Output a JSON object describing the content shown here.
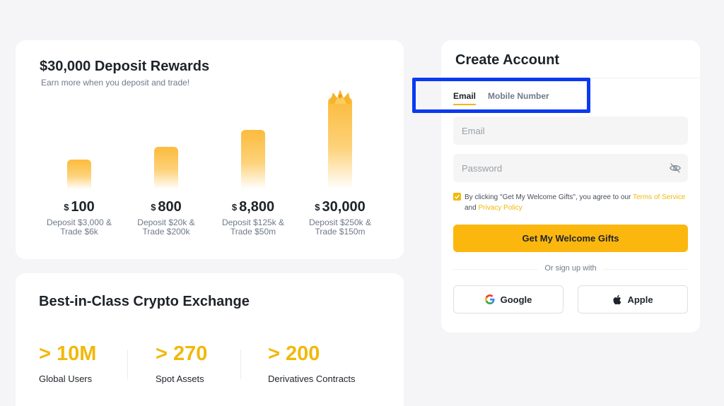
{
  "rewards": {
    "title": "$30,000 Deposit Rewards",
    "subtitle": "Earn more when you deposit and trade!",
    "currency_symbol": "$",
    "tiers": [
      {
        "amount": "100",
        "desc_line1": "Deposit $3,000 &",
        "desc_line2": "Trade $6k"
      },
      {
        "amount": "800",
        "desc_line1": "Deposit $20k &",
        "desc_line2": "Trade $200k"
      },
      {
        "amount": "8,800",
        "desc_line1": "Deposit $125k &",
        "desc_line2": "Trade $50m"
      },
      {
        "amount": "30,000",
        "desc_line1": "Deposit $250k &",
        "desc_line2": "Trade $150m"
      }
    ]
  },
  "stats": {
    "title": "Best-in-Class Crypto Exchange",
    "items": [
      {
        "value": "> 10M",
        "label": "Global Users"
      },
      {
        "value": "> 270",
        "label": "Spot Assets"
      },
      {
        "value": "> 200",
        "label": "Derivatives Contracts"
      }
    ]
  },
  "signup": {
    "title": "Create Account",
    "tabs": [
      {
        "label": "Email",
        "active": true
      },
      {
        "label": "Mobile Number",
        "active": false
      }
    ],
    "email_placeholder": "Email",
    "password_placeholder": "Password",
    "agree_prefix": "By clicking \"Get My Welcome Gifts\", you agree to our",
    "terms_link": "Terms of Service",
    "agree_and": "and",
    "privacy_link": "Privacy Policy",
    "cta_label": "Get My Welcome Gifts",
    "or_text": "Or sign up with",
    "google_label": "Google",
    "apple_label": "Apple"
  },
  "colors": {
    "accent": "#f0b90b",
    "cta": "#fcb70f",
    "highlight_box": "#0a3af0",
    "background": "#f5f5f7"
  }
}
